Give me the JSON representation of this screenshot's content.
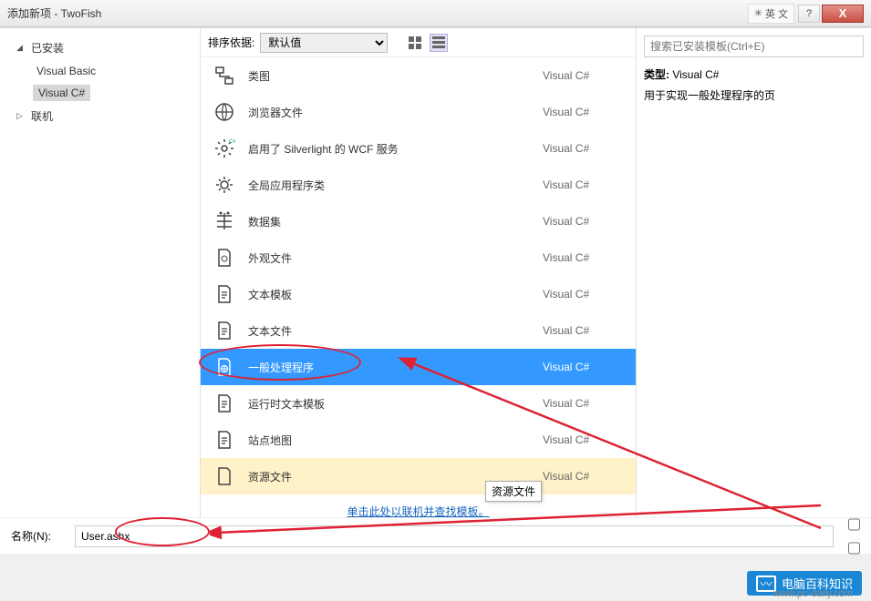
{
  "window": {
    "title": "添加新项 - TwoFish",
    "lang_badge": "英 文",
    "help": "?",
    "close": "X"
  },
  "left": {
    "installed_label": "已安装",
    "online_label": "联机",
    "items": [
      {
        "label": "Visual Basic",
        "selected": false
      },
      {
        "label": "Visual C#",
        "selected": true
      }
    ]
  },
  "center": {
    "sort_label": "排序依据:",
    "sort_value": "默认值",
    "templates": [
      {
        "label": "类图",
        "lang": "Visual C#",
        "state": ""
      },
      {
        "label": "浏览器文件",
        "lang": "Visual C#",
        "state": ""
      },
      {
        "label": "启用了 Silverlight 的 WCF 服务",
        "lang": "Visual C#",
        "state": ""
      },
      {
        "label": "全局应用程序类",
        "lang": "Visual C#",
        "state": ""
      },
      {
        "label": "数据集",
        "lang": "Visual C#",
        "state": ""
      },
      {
        "label": "外观文件",
        "lang": "Visual C#",
        "state": ""
      },
      {
        "label": "文本模板",
        "lang": "Visual C#",
        "state": ""
      },
      {
        "label": "文本文件",
        "lang": "Visual C#",
        "state": ""
      },
      {
        "label": "一般处理程序",
        "lang": "Visual C#",
        "state": "selected"
      },
      {
        "label": "运行时文本模板",
        "lang": "Visual C#",
        "state": ""
      },
      {
        "label": "站点地图",
        "lang": "Visual C#",
        "state": ""
      },
      {
        "label": "资源文件",
        "lang": "Visual C#",
        "state": "hover"
      }
    ],
    "online_link": "单击此处以联机并查找模板。",
    "tooltip": "资源文件"
  },
  "right": {
    "search_placeholder": "搜索已安装模板(Ctrl+E)",
    "type_label": "类型:",
    "type_value": "Visual C#",
    "description": "用于实现一般处理程序的页"
  },
  "bottom": {
    "name_label": "名称(N):",
    "name_value": "User.ashx"
  },
  "logo": {
    "text": "电脑百科知识",
    "url": "www.pc-daily.com"
  }
}
